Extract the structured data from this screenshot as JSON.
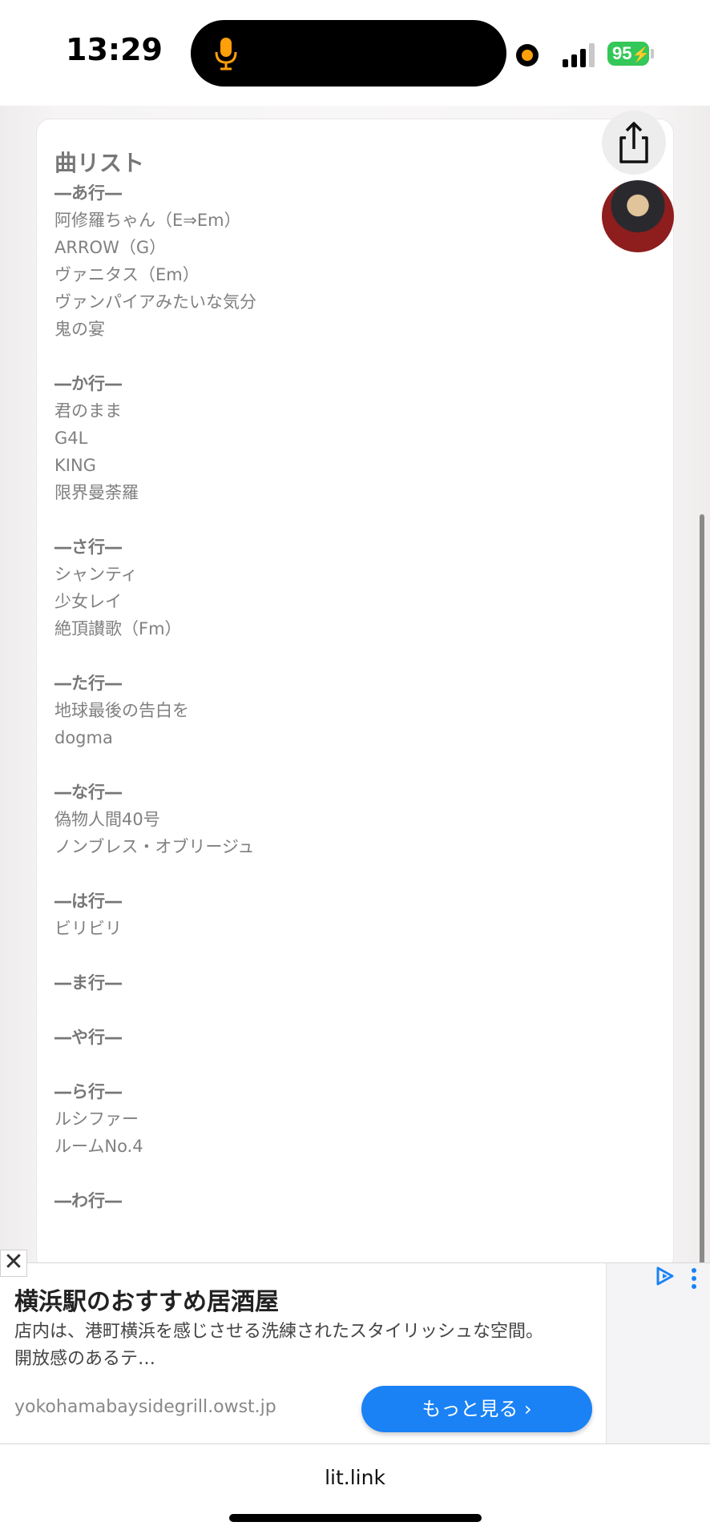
{
  "status_bar": {
    "time": "13:29",
    "battery": "95",
    "accent_mic": "#ff9f0a",
    "battery_color": "#34c759"
  },
  "card": {
    "title": "曲リスト",
    "sections": [
      {
        "heading": "―あ行―",
        "songs": [
          "阿修羅ちゃん（E⇒Em）",
          "ARROW（G）",
          "ヴァニタス（Em）",
          "ヴァンパイアみたいな気分",
          "鬼の宴"
        ]
      },
      {
        "heading": "―か行―",
        "songs": [
          "君のまま",
          "G4L",
          "KING",
          "限界曼荼羅"
        ]
      },
      {
        "heading": "―さ行―",
        "songs": [
          "シャンティ",
          "少女レイ",
          "絶頂讃歌（Fm）"
        ]
      },
      {
        "heading": "―た行―",
        "songs": [
          "地球最後の告白を",
          "dogma"
        ]
      },
      {
        "heading": "―な行―",
        "songs": [
          "偽物人間40号",
          "ノンブレス・オブリージュ"
        ]
      },
      {
        "heading": "―は行―",
        "songs": [
          "ビリビリ"
        ]
      },
      {
        "heading": "―ま行―",
        "songs": []
      },
      {
        "heading": "―や行―",
        "songs": []
      },
      {
        "heading": "―ら行―",
        "songs": [
          "ルシファー",
          "ルームNo.4"
        ]
      },
      {
        "heading": "―わ行―",
        "songs": []
      }
    ]
  },
  "icons": {
    "share": "share-icon",
    "avatar": "avatar"
  },
  "ad": {
    "title": "横浜駅のおすすめ居酒屋",
    "description": "店内は、港町横浜を感じさせる洗練されたスタイリッシュな空間。開放感のあるテ…",
    "domain": "yokohamabaysidegrill.owst.jp",
    "cta": "もっと見る ›",
    "close": "✕",
    "cta_color": "#1a82f5"
  },
  "browser": {
    "url": "lit.link"
  }
}
